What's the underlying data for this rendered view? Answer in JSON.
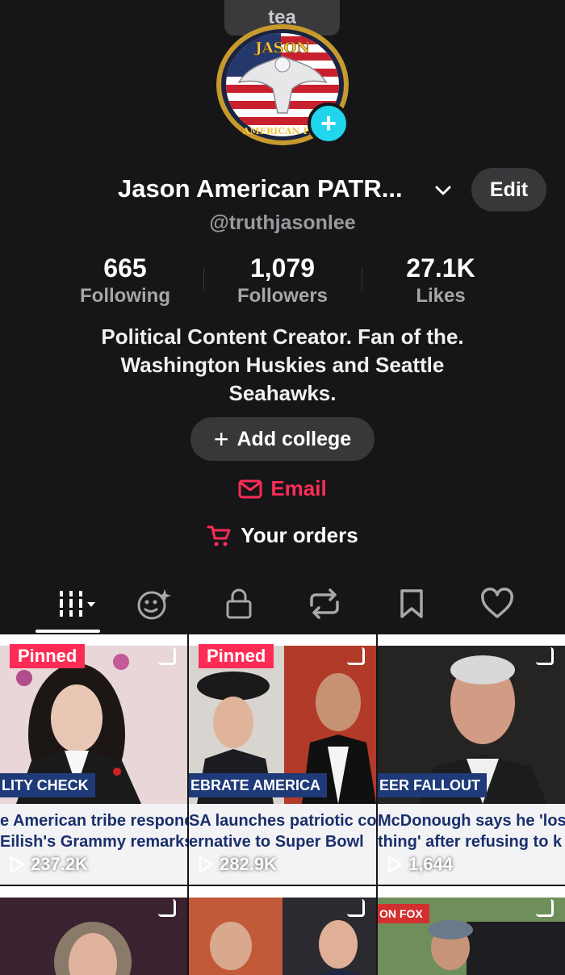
{
  "top_pill": "tea",
  "profile": {
    "name": "Jason American PATR...",
    "handle": "@truthjasonlee",
    "edit_label": "Edit",
    "avatar_alt_text": [
      "JASON",
      "AMERICAN PAT"
    ]
  },
  "stats": [
    {
      "value": "665",
      "label": "Following"
    },
    {
      "value": "1,079",
      "label": "Followers"
    },
    {
      "value": "27.1K",
      "label": "Likes"
    }
  ],
  "bio": "Political Content Creator. Fan of the. Washington Huskies and Seattle Seahawks.",
  "add_college_label": "Add college",
  "email_label": "Email",
  "orders_label": "Your orders",
  "tabs": [
    {
      "icon": "grid-icon",
      "active": true
    },
    {
      "icon": "reposts-face-icon"
    },
    {
      "icon": "lock-icon"
    },
    {
      "icon": "repost-icon"
    },
    {
      "icon": "bookmark-icon"
    },
    {
      "icon": "heart-icon"
    }
  ],
  "videos": [
    {
      "pinned": "Pinned",
      "banner": "LITY CHECK",
      "caption_line1": "e American tribe respond",
      "caption_line2": "Eilish's Grammy remarks",
      "views": "237.2K"
    },
    {
      "pinned": "Pinned",
      "banner": "EBRATE AMERICA",
      "caption_line1": "SA launches patriotic co",
      "caption_line2": "ernative to Super Bowl",
      "views": "282.9K"
    },
    {
      "pinned": "",
      "banner": "EER FALLOUT",
      "caption_line1": "McDonough says he 'lost",
      "caption_line2": "thing' after refusing to k",
      "views": "1,644"
    }
  ],
  "row2": [
    {
      "tag": ""
    },
    {
      "tag": ""
    },
    {
      "tag": "ON FOX"
    }
  ],
  "colors": {
    "background": "#161618",
    "accent_pink": "#fe2c55",
    "badge_cyan": "#20d5ec",
    "button_bg": "#38383b"
  }
}
